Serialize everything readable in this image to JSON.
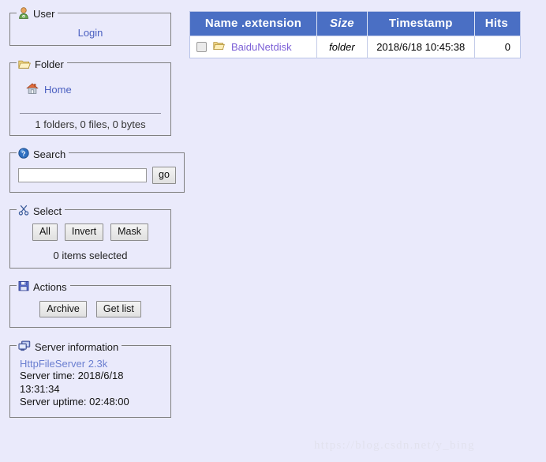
{
  "sidebar": {
    "user_panel": {
      "legend": "User",
      "icon": "user-icon",
      "login_label": "Login"
    },
    "folder_panel": {
      "legend": "Folder",
      "icon": "open-folder-icon",
      "home_label": "Home",
      "home_icon": "home-icon",
      "stats": "1 folders, 0 files, 0 bytes"
    },
    "search_panel": {
      "legend": "Search",
      "icon": "help-question-icon",
      "input_value": "",
      "input_placeholder": "",
      "go_label": "go"
    },
    "select_panel": {
      "legend": "Select",
      "icon": "scissors-icon",
      "buttons": [
        {
          "label": "All"
        },
        {
          "label": "Invert"
        },
        {
          "label": "Mask"
        }
      ],
      "selected_text": "0 items selected"
    },
    "actions_panel": {
      "legend": "Actions",
      "icon": "floppy-disk-icon",
      "buttons": [
        {
          "label": "Archive"
        },
        {
          "label": "Get list"
        }
      ]
    },
    "server_panel": {
      "legend": "Server information",
      "icon": "computer-icon",
      "version": "HttpFileServer 2.3k",
      "server_time": "Server time: 2018/6/18 13:31:34",
      "server_uptime": "Server uptime: 02:48:00"
    }
  },
  "file_table": {
    "columns": [
      {
        "label": "Name .extension"
      },
      {
        "label": "Size"
      },
      {
        "label": "Timestamp"
      },
      {
        "label": "Hits"
      }
    ],
    "rows": [
      {
        "name": "BaiduNetdisk",
        "icon": "folder-icon",
        "checked": false,
        "size": "folder",
        "timestamp": "2018/6/18 10:45:38",
        "hits": "0"
      }
    ]
  },
  "watermark": {
    "text": "https://blog.csdn.net/y_bing"
  },
  "colors": {
    "page_background": "#eaeafb",
    "table_header": "#4a6fc4",
    "link": "#4a5fc0",
    "file_link": "#7b5fd6",
    "version_text": "#6b7fd0"
  }
}
